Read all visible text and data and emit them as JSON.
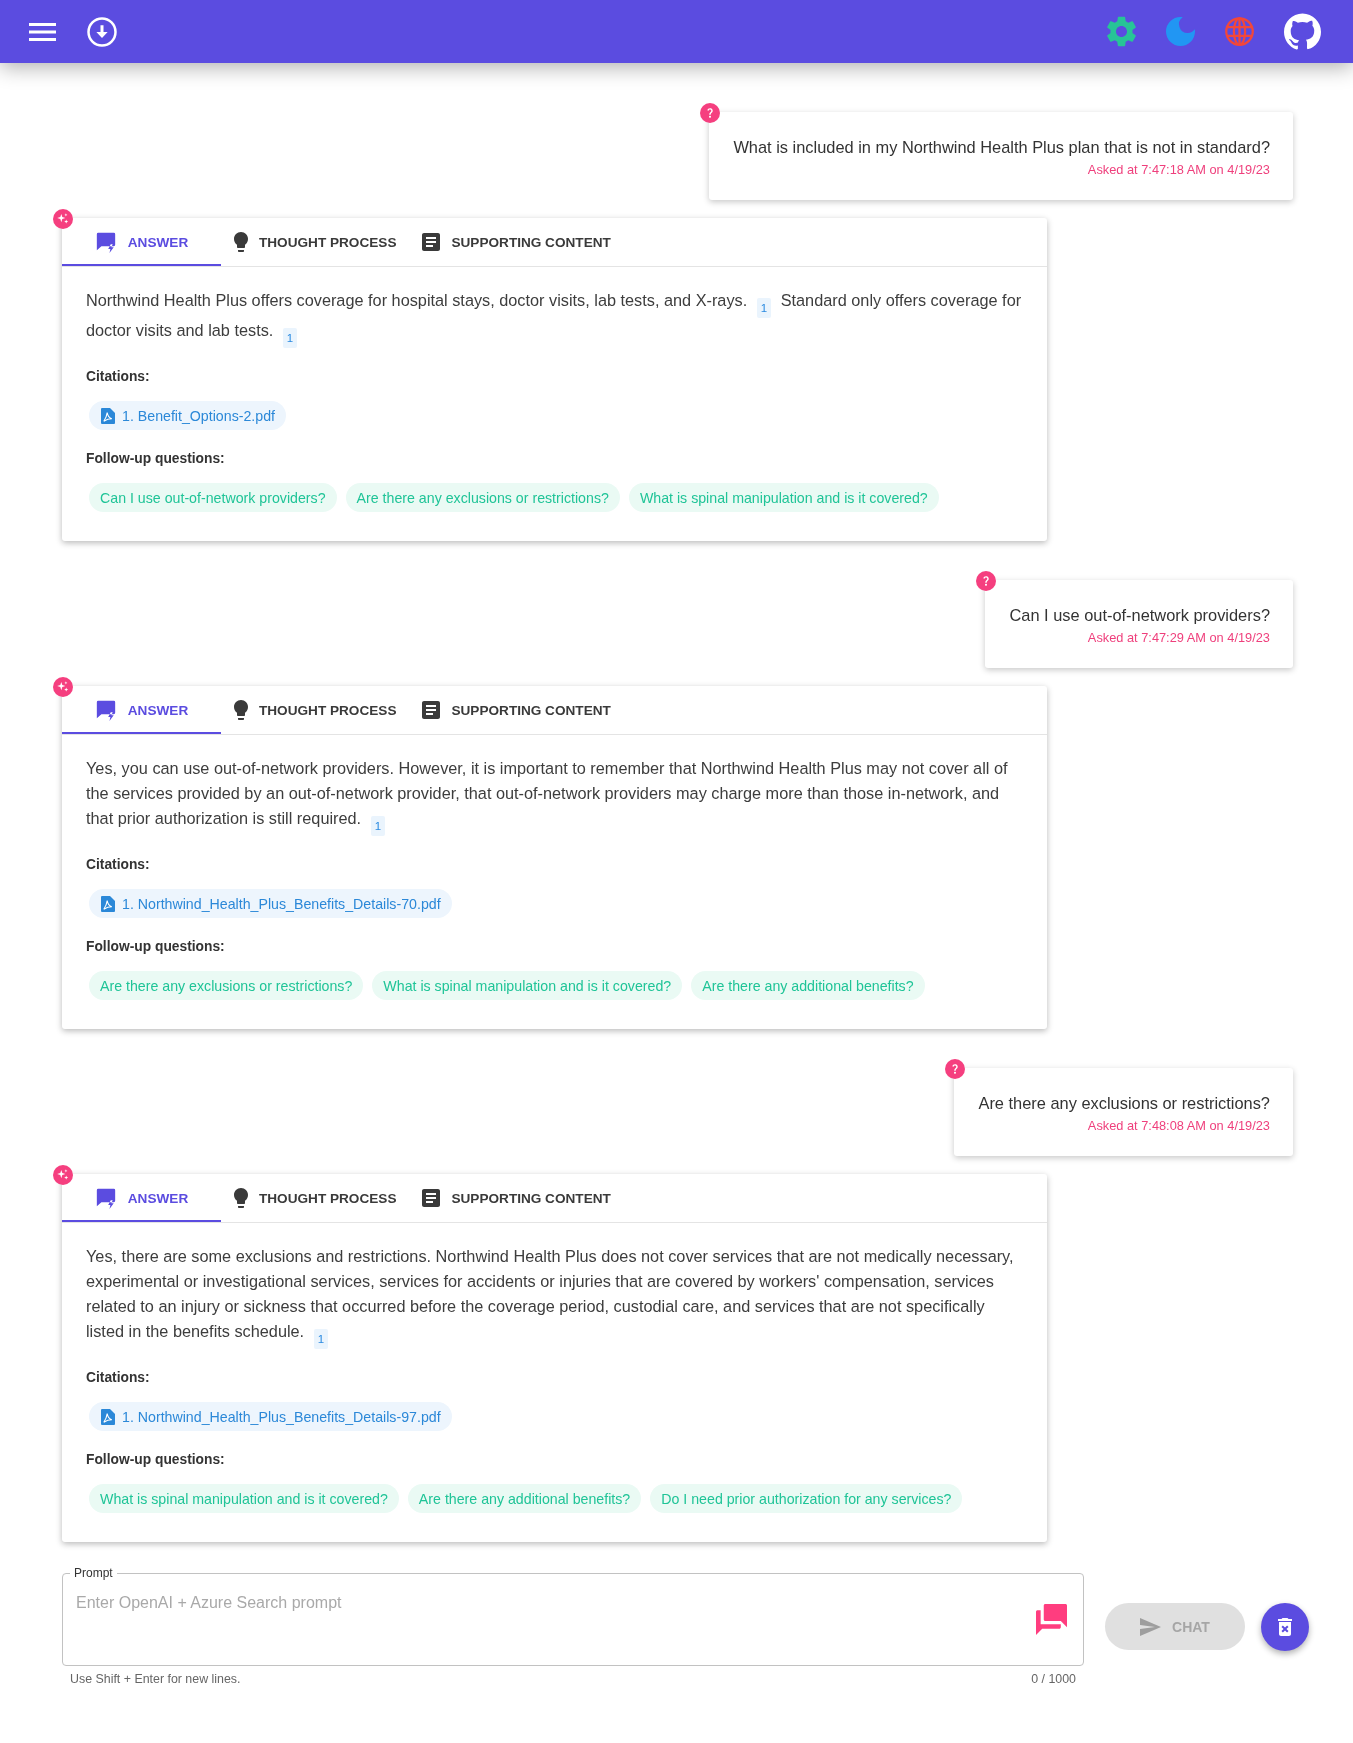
{
  "conversation": [
    {
      "kind": "question",
      "text": "What is included in my Northwind Health Plus plan that is not in standard?",
      "asked_at": "Asked at 7:47:18 AM on 4/19/23"
    },
    {
      "kind": "answer",
      "tabs": [
        {
          "kind": "answer",
          "label": "ANSWER",
          "selected": true
        },
        {
          "kind": "thought",
          "label": "THOUGHT PROCESS",
          "selected": false
        },
        {
          "kind": "supporting",
          "label": "SUPPORTING CONTENT",
          "selected": false
        }
      ],
      "answer_parts": [
        {
          "kind": "text",
          "text": "Northwind Health Plus offers coverage for hospital stays, doctor visits, lab tests, and X-rays."
        },
        {
          "kind": "ref",
          "text": "1"
        },
        {
          "kind": "text",
          "text": "Standard only offers coverage for doctor visits and lab tests."
        },
        {
          "kind": "ref",
          "text": "1"
        }
      ],
      "citations_label": "Citations:",
      "citations": [
        "1. Benefit_Options-2.pdf"
      ],
      "followups_label": "Follow-up questions:",
      "followups": [
        "Can I use out-of-network providers?",
        "Are there any exclusions or restrictions?",
        "What is spinal manipulation and is it covered?"
      ]
    },
    {
      "kind": "question",
      "text": "Can I use out-of-network providers?",
      "asked_at": "Asked at 7:47:29 AM on 4/19/23"
    },
    {
      "kind": "answer",
      "tabs": [
        {
          "kind": "answer",
          "label": "ANSWER",
          "selected": true
        },
        {
          "kind": "thought",
          "label": "THOUGHT PROCESS",
          "selected": false
        },
        {
          "kind": "supporting",
          "label": "SUPPORTING CONTENT",
          "selected": false
        }
      ],
      "answer_parts": [
        {
          "kind": "text",
          "text": "Yes, you can use out-of-network providers. However, it is important to remember that Northwind Health Plus may not cover all of the services provided by an out-of-network provider, that out-of-network providers may charge more than those in-network, and that prior authorization is still required."
        },
        {
          "kind": "ref",
          "text": "1"
        }
      ],
      "citations_label": "Citations:",
      "citations": [
        "1. Northwind_Health_Plus_Benefits_Details-70.pdf"
      ],
      "followups_label": "Follow-up questions:",
      "followups": [
        "Are there any exclusions or restrictions?",
        "What is spinal manipulation and is it covered?",
        "Are there any additional benefits?"
      ]
    },
    {
      "kind": "question",
      "text": "Are there any exclusions or restrictions?",
      "asked_at": "Asked at 7:48:08 AM on 4/19/23"
    },
    {
      "kind": "answer",
      "tabs": [
        {
          "kind": "answer",
          "label": "ANSWER",
          "selected": true
        },
        {
          "kind": "thought",
          "label": "THOUGHT PROCESS",
          "selected": false
        },
        {
          "kind": "supporting",
          "label": "SUPPORTING CONTENT",
          "selected": false
        }
      ],
      "answer_parts": [
        {
          "kind": "text",
          "text": "Yes, there are some exclusions and restrictions. Northwind Health Plus does not cover services that are not medically necessary, experimental or investigational services, services for accidents or injuries that are covered by workers' compensation, services related to an injury or sickness that occurred before the coverage period, custodial care, and services that are not specifically listed in the benefits schedule."
        },
        {
          "kind": "ref",
          "text": "1"
        }
      ],
      "citations_label": "Citations:",
      "citations": [
        "1. Northwind_Health_Plus_Benefits_Details-97.pdf"
      ],
      "followups_label": "Follow-up questions:",
      "followups": [
        "What is spinal manipulation and is it covered?",
        "Are there any additional benefits?",
        "Do I need prior authorization for any services?"
      ]
    }
  ],
  "prompt": {
    "label": "Prompt",
    "placeholder": "Enter OpenAI + Azure Search prompt",
    "helper": "Use Shift + Enter for new lines.",
    "counter": "0 / 1000"
  },
  "chat_button": {
    "label": "CHAT",
    "disabled": true
  }
}
